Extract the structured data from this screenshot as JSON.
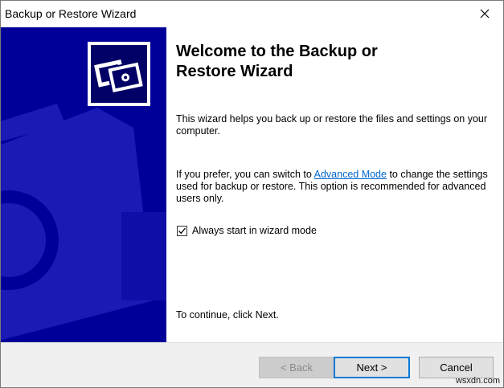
{
  "window": {
    "title": "Backup or Restore Wizard"
  },
  "content": {
    "heading": "Welcome to the Backup or Restore Wizard",
    "intro": "This wizard helps you back up or restore the files and settings on your computer.",
    "advanced_prefix": "If you prefer, you can switch to ",
    "advanced_link": "Advanced Mode",
    "advanced_suffix": " to change the settings used for backup or restore. This option is recommended for advanced users only.",
    "checkbox_label": "Always start in wizard mode",
    "checkbox_checked": true,
    "continue_text": "To continue, click Next."
  },
  "buttons": {
    "back": "< Back",
    "next": "Next >",
    "cancel": "Cancel"
  },
  "watermark": "wsxdn.com",
  "colors": {
    "side_panel": "#000099",
    "link": "#0066cc",
    "default_button_border": "#0078d7"
  },
  "icons": {
    "close": "close-icon",
    "logo": "backup-wizard-logo"
  }
}
